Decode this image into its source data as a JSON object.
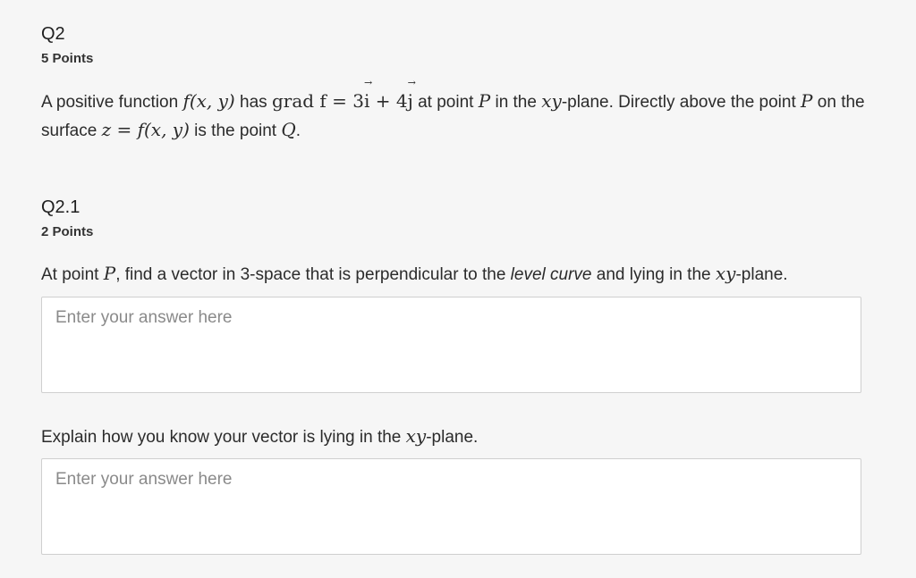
{
  "q2": {
    "title": "Q2",
    "points": "5 Points",
    "text": {
      "p1": "A positive function ",
      "f_xy": "f(x, y)",
      "p2": " has ",
      "grad": "grad f",
      "eq": " = 3",
      "i": "i",
      "plus4": " + 4",
      "j": "j",
      "p3": " at point ",
      "P": "P",
      "p4": " in the ",
      "xy": "xy",
      "p5": "-plane. Directly above the point ",
      "P2": "P",
      "p6": " on the surface ",
      "z_eq": "z = f(x, y)",
      "p7": " is the point ",
      "Q": "Q",
      "p8": "."
    }
  },
  "q2_1": {
    "title": "Q2.1",
    "points": "2 Points",
    "prompt1": {
      "a": "At point ",
      "P": "P",
      "b": ", find a vector in 3-space that is perpendicular to the ",
      "level": "level curve",
      "c": " and lying in the ",
      "xy": "xy",
      "d": "-plane."
    },
    "answer1_placeholder": "Enter your answer here",
    "prompt2": {
      "a": "Explain how you know your vector is lying in the ",
      "xy": "xy",
      "b": "-plane."
    },
    "answer2_placeholder": "Enter your answer here"
  }
}
